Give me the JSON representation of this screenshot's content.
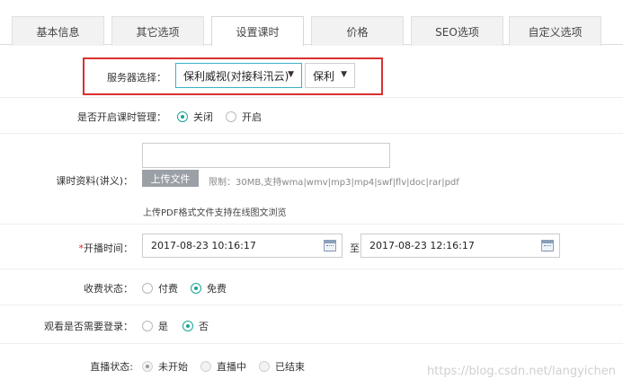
{
  "tabs": [
    {
      "label": "基本信息"
    },
    {
      "label": "其它选项"
    },
    {
      "label": "设置课时"
    },
    {
      "label": "价格"
    },
    {
      "label": "SEO选项"
    },
    {
      "label": "自定义选项"
    }
  ],
  "server": {
    "label": "服务器选择：",
    "primary_value": "保利威视(对接科汛云)",
    "secondary_value": "保利"
  },
  "lesson_mgmt": {
    "label": "是否开启课时管理：",
    "options": [
      "关闭",
      "开启"
    ],
    "selected": "关闭"
  },
  "materials": {
    "label": "课时资料(讲义)：",
    "upload_label": "上传文件",
    "limit_text": "限制：30MB,支持wma|wmv|mp3|mp4|swf|flv|doc|rar|pdf",
    "note": "上传PDF格式文件支持在线图文浏览"
  },
  "broadcast_time": {
    "required_mark": "*",
    "label": "开播时间：",
    "start": "2017-08-23 10:16:17",
    "to": "至",
    "end": "2017-08-23 12:16:17"
  },
  "fee_status": {
    "label": "收费状态：",
    "options": [
      "付费",
      "免费"
    ],
    "selected": "免费"
  },
  "login_required": {
    "label": "观看是否需要登录：",
    "options": [
      "是",
      "否"
    ],
    "selected": "否"
  },
  "live_status": {
    "label": "直播状态:",
    "options": [
      "未开始",
      "直播中",
      "已结束"
    ],
    "selected": "未开始"
  },
  "watermark": "https://blog.csdn.net/langyichen"
}
